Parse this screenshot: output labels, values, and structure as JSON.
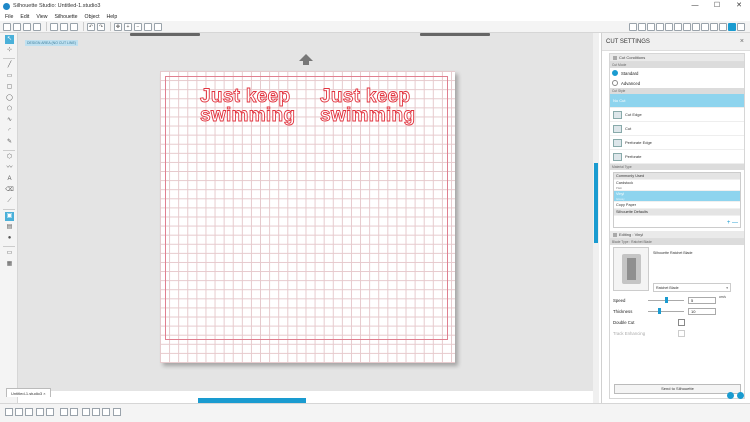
{
  "window": {
    "title": "Silhouette Studio: Untitled-1.studio3",
    "controls": [
      "—",
      "☐",
      "✕"
    ]
  },
  "menu": [
    "File",
    "Edit",
    "View",
    "Silhouette",
    "Object",
    "Help"
  ],
  "canvas": {
    "media_label": "DESIGN AREA (NO CUT LINE)",
    "text_line1": "Just keep",
    "text_line2": "swimming",
    "colors": {
      "background": "#e4e4e4",
      "grid": "#e6c9cc",
      "text_outline": "#e2343f",
      "cut_border": "#e08090"
    }
  },
  "doc_tab": "Untitled-1.studio3",
  "accent_color": "#1a9bd0",
  "panel": {
    "title": "CUT SETTINGS",
    "cut_conditions": {
      "header": "Cut Conditions",
      "mode_label": "Cut Mode",
      "modes": [
        "Standard",
        "Advanced"
      ],
      "selected_mode": "Standard",
      "style_label": "Cut Style",
      "styles": [
        "No Cut",
        "Cut Edge",
        "Cut",
        "Perforate Edge",
        "Perforate"
      ],
      "selected_style": "No Cut",
      "material_label": "Material Type",
      "materials": [
        {
          "name": "Commonly Used",
          "sub": "",
          "group": true
        },
        {
          "name": "Cardstock",
          "sub": "Plain",
          "group": false
        },
        {
          "name": "Vinyl",
          "sub": "Glossy",
          "group": false,
          "selected": true
        },
        {
          "name": "Copy Paper",
          "sub": "",
          "group": false
        },
        {
          "name": "Silhouette Defaults",
          "sub": "",
          "group": true
        }
      ],
      "add_remove": "+ —"
    },
    "editing": {
      "header": "Editing : Vinyl",
      "blade_label": "Blade Type : Ratchet Blade",
      "blade_name": "Silhouette Ratchet Blade",
      "blade_select": "Ratchet Blade",
      "speed_label": "Speed",
      "speed_value": "5",
      "speed_unit": "cm/s",
      "speed_level": 0.5,
      "thickness_label": "Thickness",
      "thickness_value": "10",
      "thickness_level": 0.3,
      "double_cut_label": "Double Cut",
      "track_label": "Track Enhancing"
    },
    "send_button": "Send to Silhouette"
  }
}
